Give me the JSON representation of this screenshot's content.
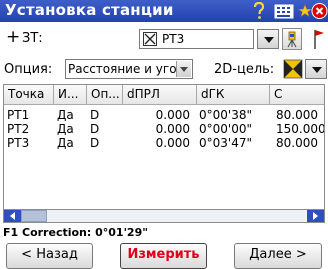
{
  "window": {
    "title": "Установка станции",
    "colors": {
      "titlebar": "#2845b4",
      "title_text": "#ffffff",
      "close_button": "#e00000"
    }
  },
  "header_icons": [
    "help-icon",
    "keyboard-icon",
    "star-icon",
    "close-icon"
  ],
  "station": {
    "plus_label": "+",
    "label": "ЗТ:",
    "checkbox_icon": "checked-box-icon",
    "value": "PT3"
  },
  "options": {
    "label": "Опция:",
    "value": "Расстояние и угол",
    "target_label": "2D-цель:"
  },
  "table": {
    "columns": [
      "Точка",
      "И...",
      "Оп...",
      "dПРЛ",
      "dГК",
      "С"
    ],
    "rows": [
      [
        "PT1",
        "Да",
        "D",
        "0.000",
        "0°00'38\"",
        "80.000"
      ],
      [
        "PT2",
        "Да",
        "D",
        "0.000",
        "0°00'00\"",
        "150.000"
      ],
      [
        "PT3",
        "Да",
        "D",
        "0.000",
        "0°03'47\"",
        "80.000"
      ]
    ]
  },
  "status": "F1 Correction: 0°01'29\"",
  "buttons": {
    "back": "< Назад",
    "measure": "Измерить",
    "next": "Далее >"
  }
}
